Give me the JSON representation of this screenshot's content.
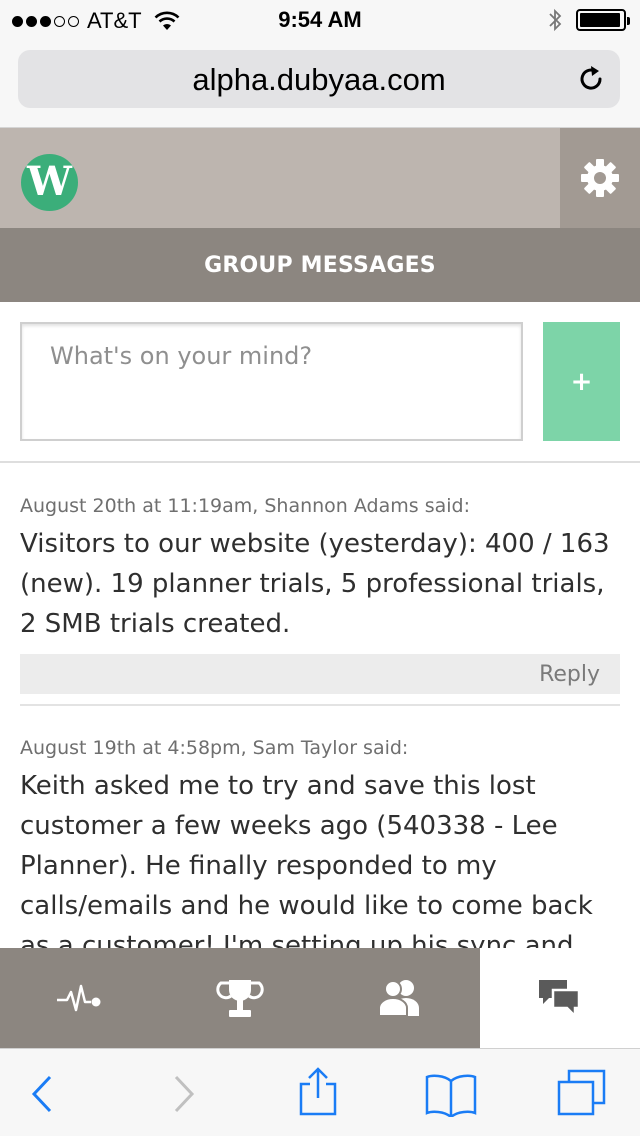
{
  "status_bar": {
    "carrier": "AT&T",
    "time": "9:54 AM",
    "signal_bars_filled": 3,
    "signal_bars_total": 5,
    "battery_level": 0.95
  },
  "browser": {
    "url": "alpha.dubyaa.com"
  },
  "app": {
    "logo_letter": "W",
    "page_title": "GROUP MESSAGES",
    "composer_placeholder": "What's on your mind?",
    "add_label": "+",
    "colors": {
      "header": "#bdb5af",
      "title_bar": "#8c8680",
      "accent_green": "#7dd4a8",
      "logo_green": "#3bae7a"
    }
  },
  "messages": [
    {
      "meta": "August 20th at 11:19am, Shannon Adams said:",
      "body": "Visitors to our website (yesterday): 400 / 163 (new). 19 planner trials, 5 professional trials, 2 SMB trials created.",
      "reply_label": "Reply"
    },
    {
      "meta": "August 19th at 4:58pm, Sam Taylor said:",
      "body": "Keith asked me to try and save this lost customer a few weeks ago (540338 - Lee Planner). He finally responded to my calls/emails and he would like to come back as a customer! I'm setting up his sync and"
    }
  ],
  "tabs": [
    {
      "icon": "activity-icon",
      "active": false
    },
    {
      "icon": "trophy-icon",
      "active": false
    },
    {
      "icon": "group-icon",
      "active": false
    },
    {
      "icon": "chat-icon",
      "active": true
    }
  ],
  "toolbar_icons": [
    "back-icon",
    "forward-icon",
    "share-icon",
    "bookmarks-icon",
    "tabs-icon"
  ]
}
